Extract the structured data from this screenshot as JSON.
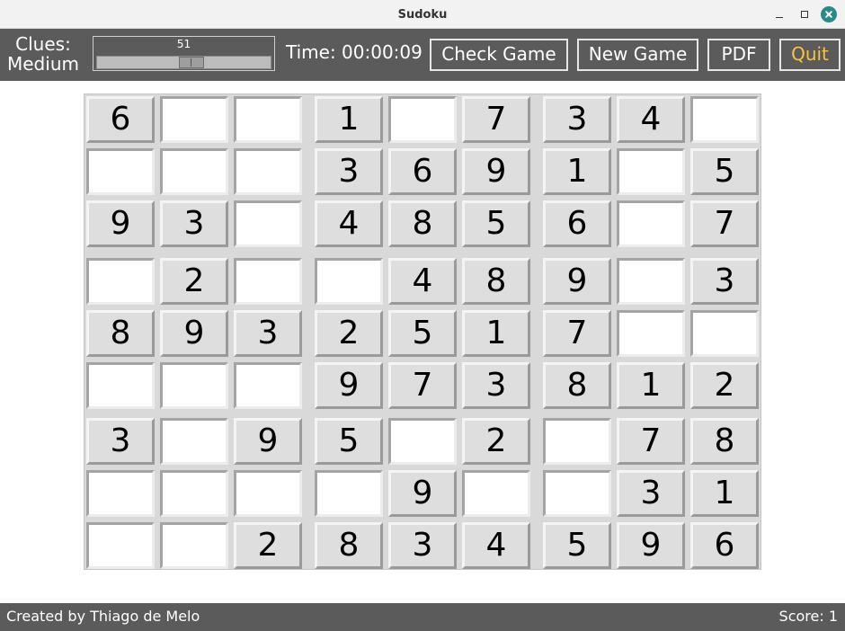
{
  "window": {
    "title": "Sudoku"
  },
  "toolbar": {
    "clues_label": "Clues:",
    "clues_level": "Medium",
    "clues_value": "51",
    "clues_slider_fraction": 0.55,
    "timer_label": "Time: 00:00:09",
    "check_label": "Check Game",
    "new_label": "New Game",
    "pdf_label": "PDF",
    "quit_label": "Quit"
  },
  "colors": {
    "toolbar_bg": "#5b5b5b",
    "quit_text": "#f4c542",
    "close_button": "#2a8a8a"
  },
  "board": {
    "rows": [
      [
        "6",
        "",
        "",
        "1",
        "",
        "7",
        "3",
        "4",
        ""
      ],
      [
        "",
        "",
        "",
        "3",
        "6",
        "9",
        "1",
        "",
        "5"
      ],
      [
        "9",
        "3",
        "",
        "4",
        "8",
        "5",
        "6",
        "",
        "7"
      ],
      [
        "",
        "2",
        "",
        "",
        "4",
        "8",
        "9",
        "",
        "3"
      ],
      [
        "8",
        "9",
        "3",
        "2",
        "5",
        "1",
        "7",
        "",
        ""
      ],
      [
        "",
        "",
        "",
        "9",
        "7",
        "3",
        "8",
        "1",
        "2"
      ],
      [
        "3",
        "",
        "9",
        "5",
        "",
        "2",
        "",
        "7",
        "8"
      ],
      [
        "",
        "",
        "",
        "",
        "9",
        "",
        "",
        "3",
        "1"
      ],
      [
        "",
        "",
        "2",
        "8",
        "3",
        "4",
        "5",
        "9",
        "6"
      ]
    ]
  },
  "status": {
    "credit": "Created by Thiago de Melo",
    "score": "Score: 1"
  }
}
